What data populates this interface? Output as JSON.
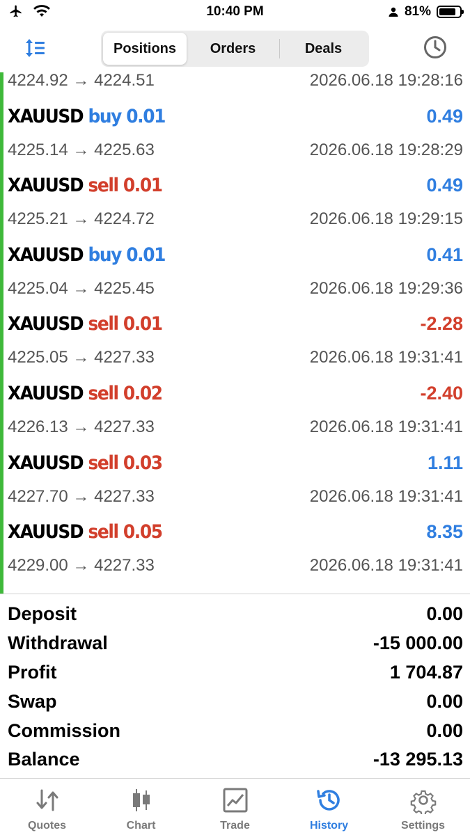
{
  "status_bar": {
    "time": "10:40 PM",
    "battery": "81%",
    "battery_level": 0.81
  },
  "header": {
    "tabs": [
      {
        "label": "Positions",
        "active": true
      },
      {
        "label": "Orders",
        "active": false
      },
      {
        "label": "Deals",
        "active": false
      }
    ]
  },
  "deals": [
    {
      "symbol": "",
      "direction": "",
      "volume": "",
      "profit": "",
      "prices": "4224.92 → 4224.51",
      "time": "2026.06.18 19:28:16"
    },
    {
      "symbol": "XAUUSD",
      "direction": "buy",
      "volume": "0.01",
      "profit": "0.49",
      "prices": "4225.14 → 4225.63",
      "time": "2026.06.18 19:28:29"
    },
    {
      "symbol": "XAUUSD",
      "direction": "sell",
      "volume": "0.01",
      "profit": "0.49",
      "prices": "4225.21 → 4224.72",
      "time": "2026.06.18 19:29:15"
    },
    {
      "symbol": "XAUUSD",
      "direction": "buy",
      "volume": "0.01",
      "profit": "0.41",
      "prices": "4225.04 → 4225.45",
      "time": "2026.06.18 19:29:36"
    },
    {
      "symbol": "XAUUSD",
      "direction": "sell",
      "volume": "0.01",
      "profit": "-2.28",
      "prices": "4225.05 → 4227.33",
      "time": "2026.06.18 19:31:41"
    },
    {
      "symbol": "XAUUSD",
      "direction": "sell",
      "volume": "0.02",
      "profit": "-2.40",
      "prices": "4226.13 → 4227.33",
      "time": "2026.06.18 19:31:41"
    },
    {
      "symbol": "XAUUSD",
      "direction": "sell",
      "volume": "0.03",
      "profit": "1.11",
      "prices": "4227.70 → 4227.33",
      "time": "2026.06.18 19:31:41"
    },
    {
      "symbol": "XAUUSD",
      "direction": "sell",
      "volume": "0.05",
      "profit": "8.35",
      "prices": "4229.00 → 4227.33",
      "time": "2026.06.18 19:31:41"
    }
  ],
  "summary": [
    {
      "label": "Deposit",
      "value": "0.00"
    },
    {
      "label": "Withdrawal",
      "value": "-15 000.00"
    },
    {
      "label": "Profit",
      "value": "1 704.87"
    },
    {
      "label": "Swap",
      "value": "0.00"
    },
    {
      "label": "Commission",
      "value": "0.00"
    },
    {
      "label": "Balance",
      "value": "-13 295.13"
    }
  ],
  "tabbar": [
    {
      "label": "Quotes",
      "icon": "quotes-icon",
      "active": false
    },
    {
      "label": "Chart",
      "icon": "chart-icon",
      "active": false
    },
    {
      "label": "Trade",
      "icon": "trade-icon",
      "active": false
    },
    {
      "label": "History",
      "icon": "history-icon",
      "active": true
    },
    {
      "label": "Settings",
      "icon": "settings-icon",
      "active": false
    }
  ],
  "colors": {
    "buy": "#2f7ee0",
    "sell": "#d23f2c",
    "profit_positive": "#2f7ee0",
    "profit_negative": "#d23f2c",
    "accent": "#2f7ee0",
    "position_bar": "#3fb93a"
  }
}
